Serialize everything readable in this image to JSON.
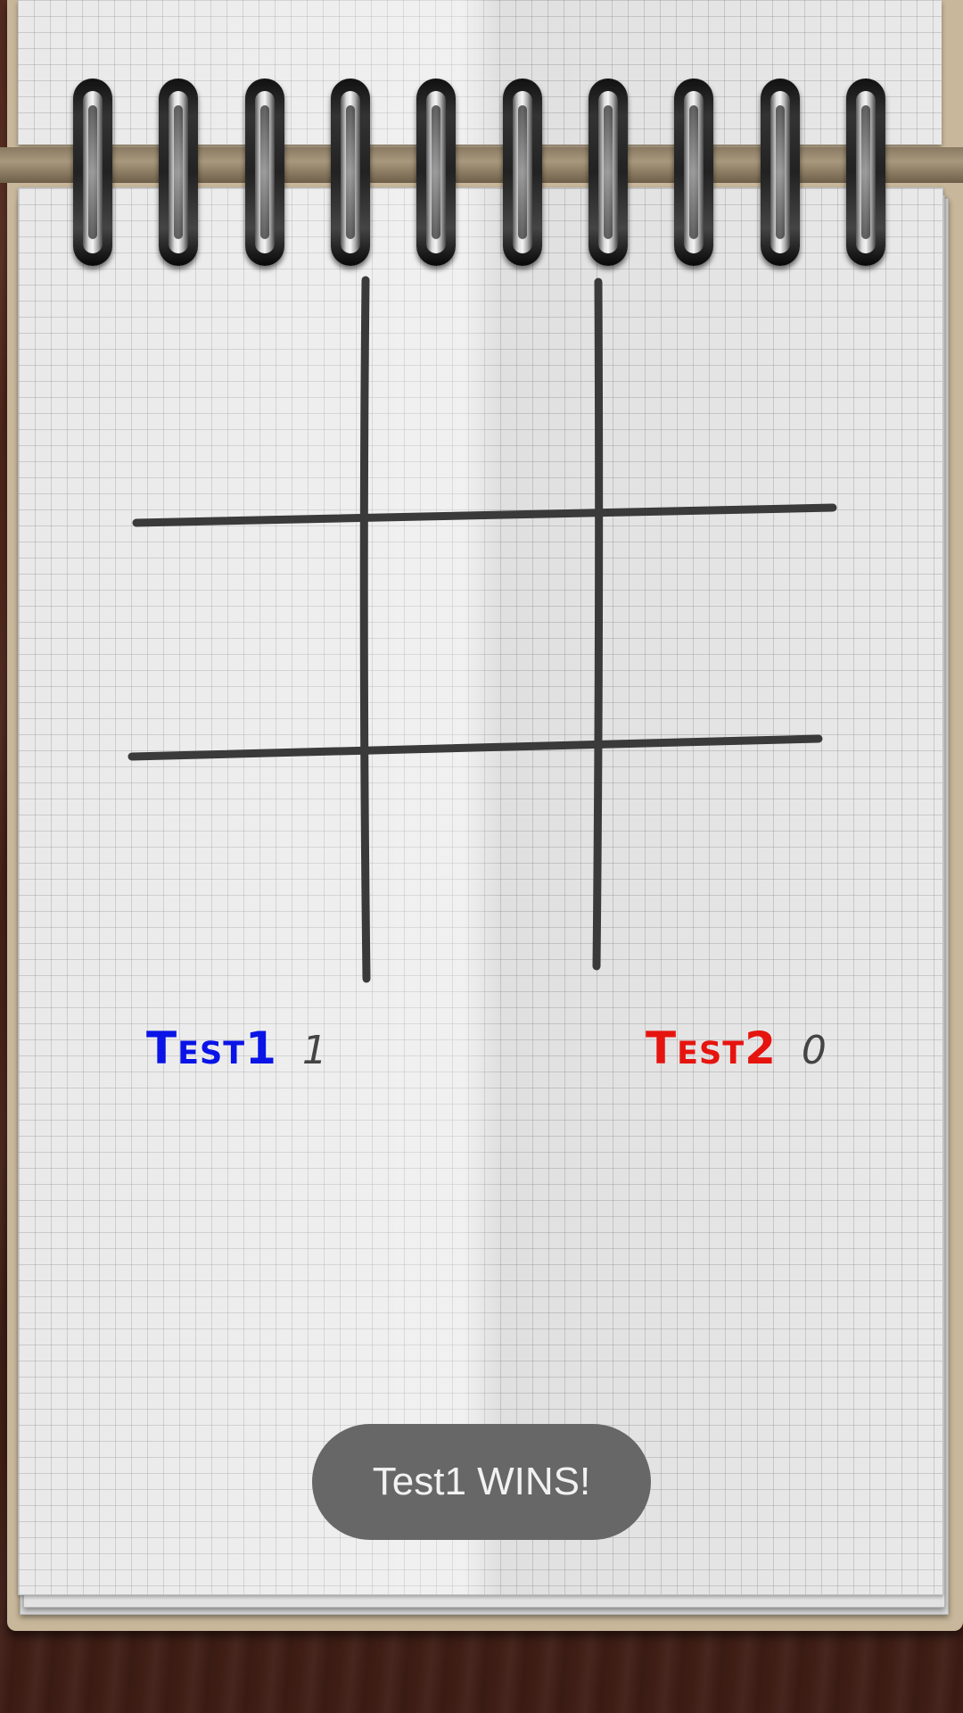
{
  "players": [
    {
      "name": "Test1",
      "score": "1",
      "color": "#0a14e6"
    },
    {
      "name": "Test2",
      "score": "0",
      "color": "#e6140f"
    }
  ],
  "board": {
    "cells": [
      "",
      "",
      "",
      "",
      "",
      "",
      "",
      "",
      ""
    ],
    "line_color": "#3a3a3a"
  },
  "toast": {
    "message": "Test1 WINS!"
  }
}
